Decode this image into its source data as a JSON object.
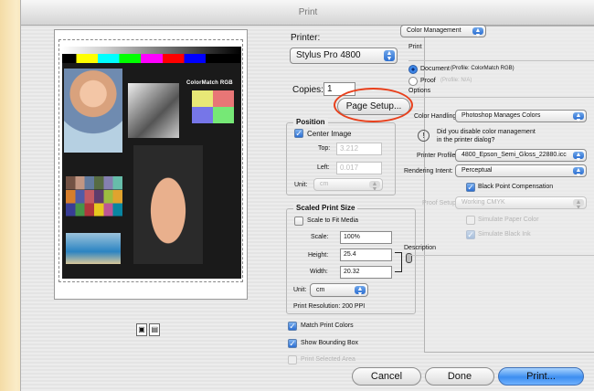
{
  "window": {
    "title": "Print"
  },
  "preview": {
    "image_label": "ColorMatch RGB",
    "thumbs": [
      "▣",
      "▤"
    ]
  },
  "printer": {
    "label": "Printer:",
    "selected": "Stylus Pro 4800",
    "copies_label": "Copies:",
    "copies_value": "1",
    "page_setup_button": "Page Setup..."
  },
  "position": {
    "title": "Position",
    "center_image_label": "Center Image",
    "center_image_checked": true,
    "top_label": "Top:",
    "top_value": "3.212",
    "left_label": "Left:",
    "left_value": "0.017",
    "unit_label": "Unit:",
    "unit_value": "cm"
  },
  "scaled": {
    "title": "Scaled Print Size",
    "scale_to_fit_label": "Scale to Fit Media",
    "scale_to_fit_checked": false,
    "scale_label": "Scale:",
    "scale_value": "100%",
    "height_label": "Height:",
    "height_value": "25.4",
    "width_label": "Width:",
    "width_value": "20.32",
    "unit_label": "Unit:",
    "unit_value": "cm",
    "resolution_text": "Print Resolution: 200 PPI"
  },
  "options": {
    "match_print_colors": "Match Print Colors",
    "show_bounding_box": "Show Bounding Box",
    "print_selected_area": "Print Selected Area"
  },
  "color_mgmt": {
    "section_popup": "Color Management",
    "print_header": "Print",
    "document_label": "Document",
    "document_profile": "(Profile: ColorMatch RGB)",
    "proof_label": "Proof",
    "proof_profile": "(Profile: N/A)",
    "options_header": "Options",
    "color_handling_label": "Color Handling:",
    "color_handling_value": "Photoshop Manages Colors",
    "warning_text_1": "Did you disable color management",
    "warning_text_2": "in the printer dialog?",
    "printer_profile_label": "Printer Profile:",
    "printer_profile_value": "4800_Epson_Semi_Gloss_22880.icc",
    "rendering_intent_label": "Rendering Intent:",
    "rendering_intent_value": "Perceptual",
    "black_point_label": "Black Point Compensation",
    "proof_setup_label": "Proof Setup:",
    "proof_setup_value": "Working CMYK",
    "simulate_paper_label": "Simulate Paper Color",
    "simulate_black_label": "Simulate Black Ink",
    "description_header": "Description"
  },
  "buttons": {
    "cancel": "Cancel",
    "done": "Done",
    "print": "Print..."
  },
  "colors": {
    "accent": "#3d8ef0",
    "highlight_circle": "#e8401c"
  }
}
